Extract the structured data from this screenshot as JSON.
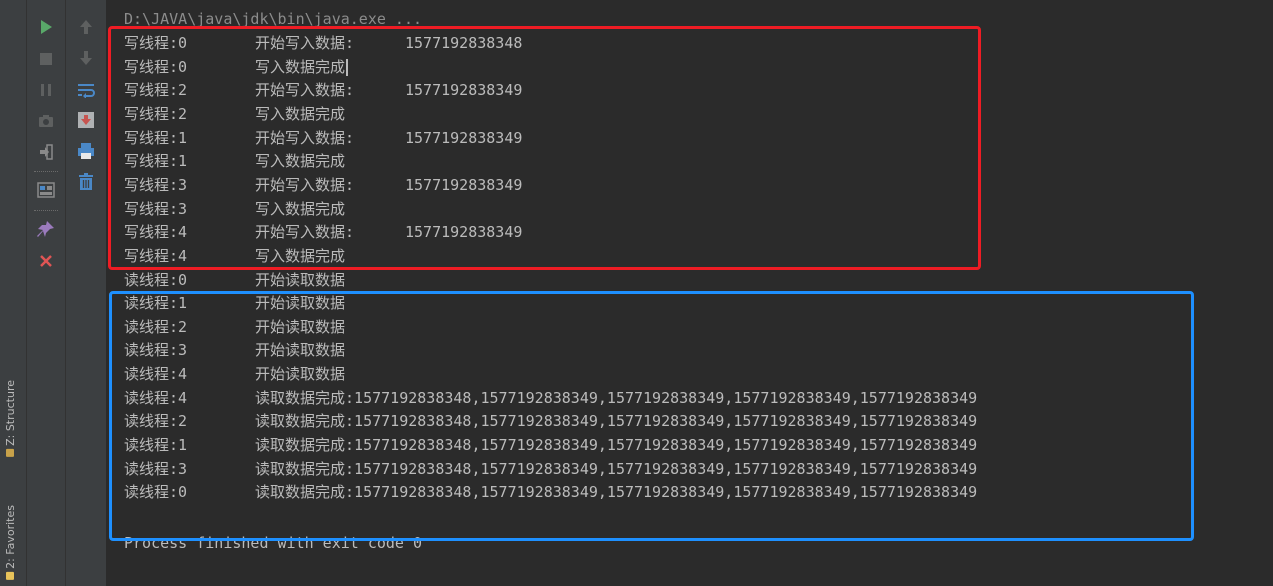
{
  "sidebar": {
    "tabs": [
      {
        "label": "Z: Structure",
        "mark_color": "#c8a24a"
      },
      {
        "label": "2: Favorites",
        "mark_color": "#e8c35a"
      }
    ]
  },
  "toolbar": {
    "rerun_icon": "play-icon",
    "stop_icon": "stop-icon",
    "pause_icon": "pause-icon",
    "dump_icon": "camera-icon",
    "exit_icon": "exit-icon",
    "layout_icon": "layout-icon",
    "pin_icon": "pin-icon",
    "close_icon": "close-icon",
    "up_icon": "arrow-up-icon",
    "down_icon": "arrow-down-icon",
    "wrap_icon": "soft-wrap-icon",
    "scroll_icon": "scroll-to-end-icon",
    "print_icon": "print-icon",
    "trash_icon": "trash-icon"
  },
  "console": {
    "command": "D:\\JAVA\\java\\jdk\\bin\\java.exe ...",
    "lines": [
      {
        "name": "写线程:0",
        "action": "开始写入数据:",
        "value": "1577192838348"
      },
      {
        "name": "写线程:0",
        "action": "写入数据完成",
        "value": ""
      },
      {
        "name": "写线程:2",
        "action": "开始写入数据:",
        "value": "1577192838349"
      },
      {
        "name": "写线程:2",
        "action": "写入数据完成",
        "value": ""
      },
      {
        "name": "写线程:1",
        "action": "开始写入数据:",
        "value": "1577192838349"
      },
      {
        "name": "写线程:1",
        "action": "写入数据完成",
        "value": ""
      },
      {
        "name": "写线程:3",
        "action": "开始写入数据:",
        "value": "1577192838349"
      },
      {
        "name": "写线程:3",
        "action": "写入数据完成",
        "value": ""
      },
      {
        "name": "写线程:4",
        "action": "开始写入数据:",
        "value": "1577192838349"
      },
      {
        "name": "写线程:4",
        "action": "写入数据完成",
        "value": ""
      },
      {
        "name": "读线程:0",
        "action": "开始读取数据",
        "value": ""
      },
      {
        "name": "读线程:1",
        "action": "开始读取数据",
        "value": ""
      },
      {
        "name": "读线程:2",
        "action": "开始读取数据",
        "value": ""
      },
      {
        "name": "读线程:3",
        "action": "开始读取数据",
        "value": ""
      },
      {
        "name": "读线程:4",
        "action": "开始读取数据",
        "value": ""
      },
      {
        "name": "读线程:4",
        "action": "读取数据完成:",
        "value": "1577192838348,1577192838349,1577192838349,1577192838349,1577192838349"
      },
      {
        "name": "读线程:2",
        "action": "读取数据完成:",
        "value": "1577192838348,1577192838349,1577192838349,1577192838349,1577192838349"
      },
      {
        "name": "读线程:1",
        "action": "读取数据完成:",
        "value": "1577192838348,1577192838349,1577192838349,1577192838349,1577192838349"
      },
      {
        "name": "读线程:3",
        "action": "读取数据完成:",
        "value": "1577192838348,1577192838349,1577192838349,1577192838349,1577192838349"
      },
      {
        "name": "读线程:0",
        "action": "读取数据完成:",
        "value": "1577192838348,1577192838349,1577192838349,1577192838349,1577192838349"
      }
    ],
    "exit_message": "Process finished with exit code 0"
  },
  "annotations": {
    "write_box_color": "#ee1c24",
    "read_box_color": "#1e90ff"
  }
}
